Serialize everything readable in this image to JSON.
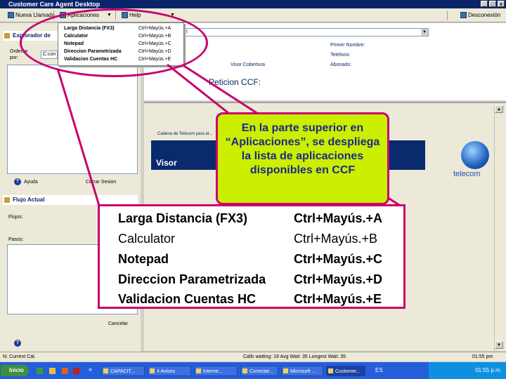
{
  "window": {
    "title": "Customer Care Agent Desktop",
    "controls": [
      "_",
      "□",
      "x"
    ]
  },
  "toolbar": {
    "new_call": "Nueva Llamada",
    "applications": "Aplicaciones",
    "help": "Help",
    "release": "Desconexión",
    "dropdown_glyph": "▼"
  },
  "menu": {
    "items": [
      {
        "label": "Larga Distancia (FX3)",
        "shortcut": "Ctrl+Mayús.+A"
      },
      {
        "label": "Calculator",
        "shortcut": "Ctrl+Mayús.+B"
      },
      {
        "label": "Notepad",
        "shortcut": "Ctrl+Mayús.+C"
      },
      {
        "label": "Direccion Parametrizada",
        "shortcut": "Ctrl+Mayús.+D"
      },
      {
        "label": "Validacion Cuentas HC",
        "shortcut": "Ctrl+Mayús.+E"
      }
    ]
  },
  "left_panel": {
    "explorer_title": "Explorador de",
    "order_label": "Ordenar",
    "by_label": "por:",
    "order_value": "C:con",
    "help_link": "Ayuda",
    "close_session": "Cerrar Sesion",
    "flow_title": "Flujo Actual",
    "flows_label": "Flujos:",
    "steps_label": "Pasos:",
    "cancel": "Cancelar"
  },
  "right_top": {
    "combo_value": "t",
    "first_name_label": "Primer Nombre:",
    "phone_label": "Telefono:",
    "coverage_label": "Visor Cobertura",
    "subscriber_label": "Abonado:",
    "peticion_label": "Peticion CCF:"
  },
  "content": {
    "breadcrumb": "Cadena de Telecom para el...",
    "visor_title": "Visor",
    "logo_text": "telecom",
    "scroll_up": "▲",
    "scroll_down": "▼"
  },
  "callout": {
    "text": "En la parte superior en “Aplicaciones”, se despliega la lista de aplicaciones disponibles en CCF"
  },
  "statusbar": {
    "user": "N: Current Cal.",
    "queue": "Calls waiting: 16  Avg Wait: 35  Longest Wait: 35",
    "time": "01:55 pm"
  },
  "taskbar": {
    "start": "Inicio",
    "overflow": "»",
    "buttons": [
      "CAPACIT...",
      "4 Avisos",
      "Interne...",
      "Conectar...",
      "Microsoft ...",
      "Customer..."
    ],
    "clock": "01:55 p.m.",
    "lang": "ES"
  },
  "colors": {
    "highlight": "#c8006e",
    "callout_bg": "#ccee00",
    "callout_text": "#1a2a8a",
    "titlebar": "#0a246a",
    "taskbar": "#245edb"
  }
}
